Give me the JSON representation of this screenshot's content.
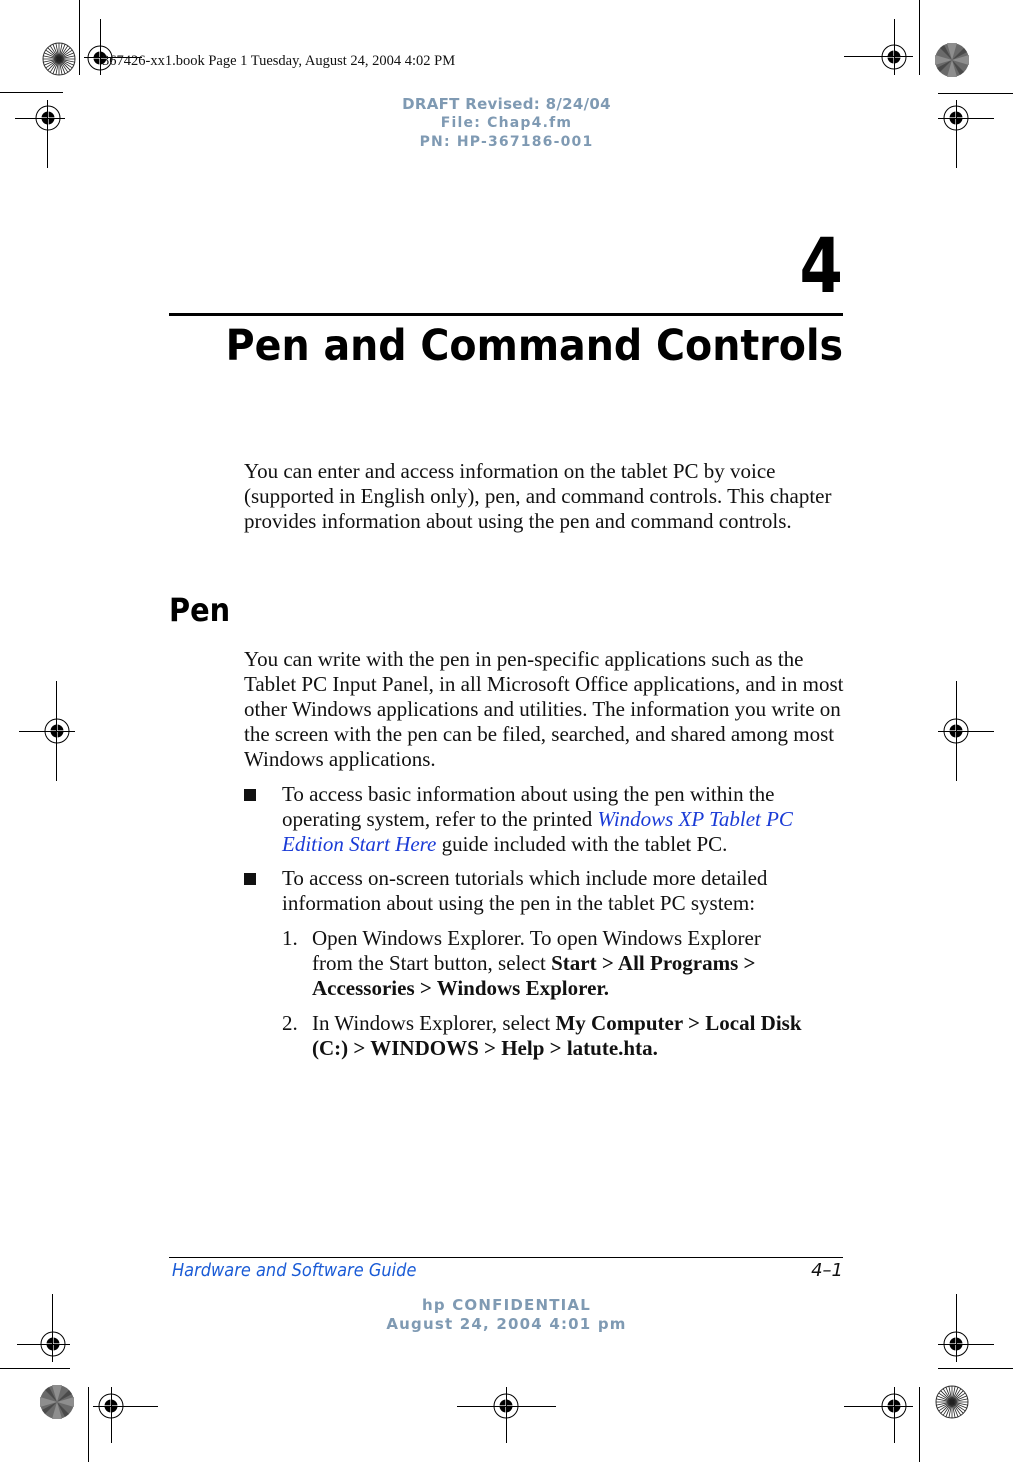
{
  "slug_line": "367426-xx1.book  Page 1  Tuesday, August 24, 2004  4:02 PM",
  "draft_header": {
    "line1": "DRAFT Revised: 8/24/04",
    "line2": "File: Chap4.fm",
    "line3": "PN: HP-367186-001"
  },
  "chapter": {
    "number": "4",
    "title": "Pen and Command Controls"
  },
  "intro_paragraph": "You can enter and access information on the tablet PC by voice (supported in English only), pen, and command controls. This chapter provides information about using the pen and command controls.",
  "section": {
    "heading": "Pen",
    "paragraph": "You can write with the pen in pen-specific applications such as the Tablet PC Input Panel, in all Microsoft Office applications, and in most other Windows applications and utilities. The information you write on the screen with the pen can be filed, searched, and shared among most Windows applications.",
    "bullets": [
      {
        "before": "To access basic information about using the pen within the operating system, refer to the printed ",
        "link": "Windows XP Tablet PC Edition Start Here",
        "after": " guide included with the tablet PC."
      },
      {
        "text": "To access on-screen tutorials which include more detailed information about using the pen in the tablet PC system:"
      }
    ],
    "steps": [
      {
        "number": "1.",
        "text": "Open Windows Explorer. To open Windows Explorer from the Start button, select ",
        "bold": "Start > All Programs > Accessories > Windows Explorer."
      },
      {
        "number": "2.",
        "text": "In Windows Explorer, select ",
        "bold": "My Computer > Local Disk (C:) > WINDOWS > Help > latute.hta."
      }
    ]
  },
  "footer": {
    "guide_title": "Hardware and Software Guide",
    "page_number": "4–1",
    "confidential_line1": "hp CONFIDENTIAL",
    "confidential_line2": "August 24, 2004 4:01 pm"
  },
  "colors": {
    "draft_gray_blue": "#7f9ab3",
    "link_blue": "#1a3bd6",
    "footer_blue": "#1a5bd6"
  },
  "icons": [
    "registration-mark-icon",
    "color-bar-starburst-icon",
    "gray-starburst-icon"
  ]
}
